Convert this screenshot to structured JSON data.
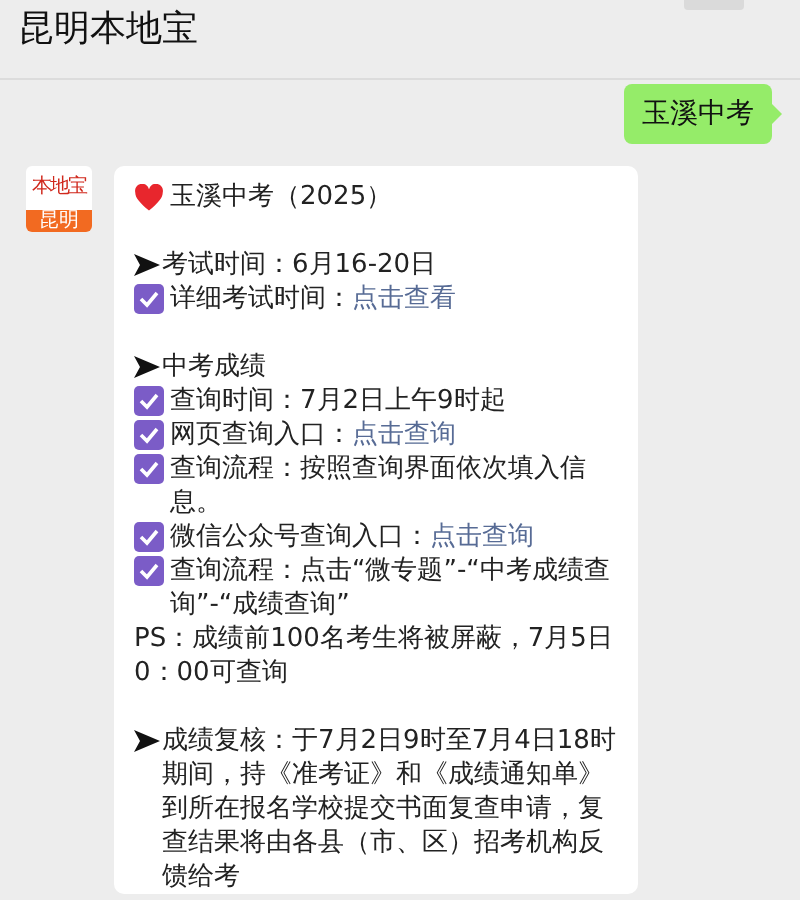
{
  "header": {
    "title": "昆明本地宝"
  },
  "messages": [
    {
      "kind": "sent",
      "text": "玉溪中考"
    },
    {
      "kind": "article",
      "avatar": {
        "brand": "本地宝",
        "city": "昆明"
      },
      "lines": [
        {
          "kind": "heart",
          "text": "玉溪中考（2025）"
        },
        {
          "kind": "gap"
        },
        {
          "kind": "arrow",
          "text": "考试时间：6月16-20日"
        },
        {
          "kind": "check",
          "text": "详细考试时间：",
          "link": "点击查看"
        },
        {
          "kind": "gap"
        },
        {
          "kind": "arrow",
          "text": "中考成绩"
        },
        {
          "kind": "check",
          "text": "查询时间：7月2日上午9时起"
        },
        {
          "kind": "check",
          "text": "网页查询入口：",
          "link": "点击查询"
        },
        {
          "kind": "check",
          "text": "查询流程：按照查询界面依次填入信息。"
        },
        {
          "kind": "check",
          "text": "微信公众号查询入口：",
          "link": "点击查询"
        },
        {
          "kind": "check",
          "text": "查询流程：点击“微专题”-“中考成绩查询”-“成绩查询”"
        },
        {
          "kind": "plain",
          "text": "PS：成绩前100名考生将被屏蔽，7月5日0：00可查询"
        },
        {
          "kind": "gap"
        },
        {
          "kind": "arrow",
          "text": "成绩复核：于7月2日9时至7月4日18时期间，持《准考证》和《成绩通知单》到所在报名学校提交书面复查申请，复查结果将由各县（市、区）招考机构反馈给考"
        }
      ]
    }
  ]
}
